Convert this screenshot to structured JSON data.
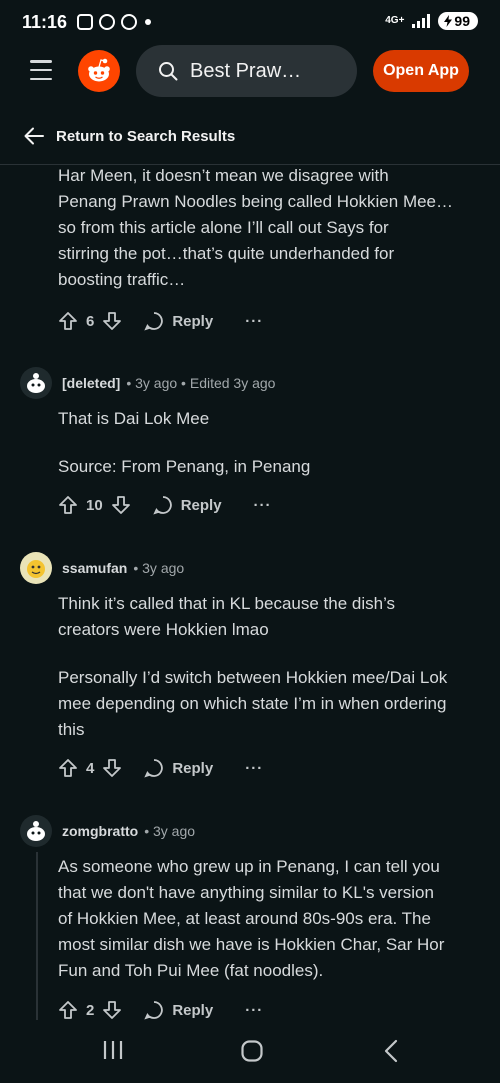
{
  "status": {
    "time": "11:16",
    "network": "4G+",
    "battery": "99"
  },
  "header": {
    "search_text": "Best Praw…",
    "open_app_label": "Open App"
  },
  "nav": {
    "return_label": "Return to Search Results"
  },
  "comments": [
    {
      "body_lines": [
        "Har Meen, it doesn’t mean we disagree with",
        "Penang Prawn Noodles being called Hokkien Mee…",
        "so from this article alone I’ll call out Says for",
        "stirring the pot…that’s quite underhanded for",
        "boosting traffic…"
      ],
      "votes": "6",
      "reply_label": "Reply",
      "more_label": "···"
    },
    {
      "username": "[deleted]",
      "meta": "• 3y ago • Edited 3y ago",
      "body_lines": [
        "That is Dai Lok Mee",
        "",
        "Source: From Penang, in Penang"
      ],
      "votes": "10",
      "reply_label": "Reply",
      "more_label": "···"
    },
    {
      "username": "ssamufan",
      "meta": "• 3y ago",
      "body_lines": [
        "Think it’s called that in KL because the dish’s",
        "creators were Hokkien lmao",
        "",
        "Personally I’d switch between Hokkien mee/Dai Lok",
        "mee depending on which state I’m in when ordering",
        "this"
      ],
      "votes": "4",
      "reply_label": "Reply",
      "more_label": "···"
    },
    {
      "username": "zomgbratto",
      "meta": "• 3y ago",
      "body_lines": [
        "As someone who grew up in Penang, I can tell you",
        "that we don't have anything similar to KL's version",
        "of Hokkien Mee, at least around 80s-90s era. The",
        "most similar dish we have is Hokkien Char, Sar Hor",
        "Fun and Toh Pui Mee (fat noodles)."
      ],
      "votes": "2",
      "reply_label": "Reply",
      "more_label": "···"
    }
  ]
}
